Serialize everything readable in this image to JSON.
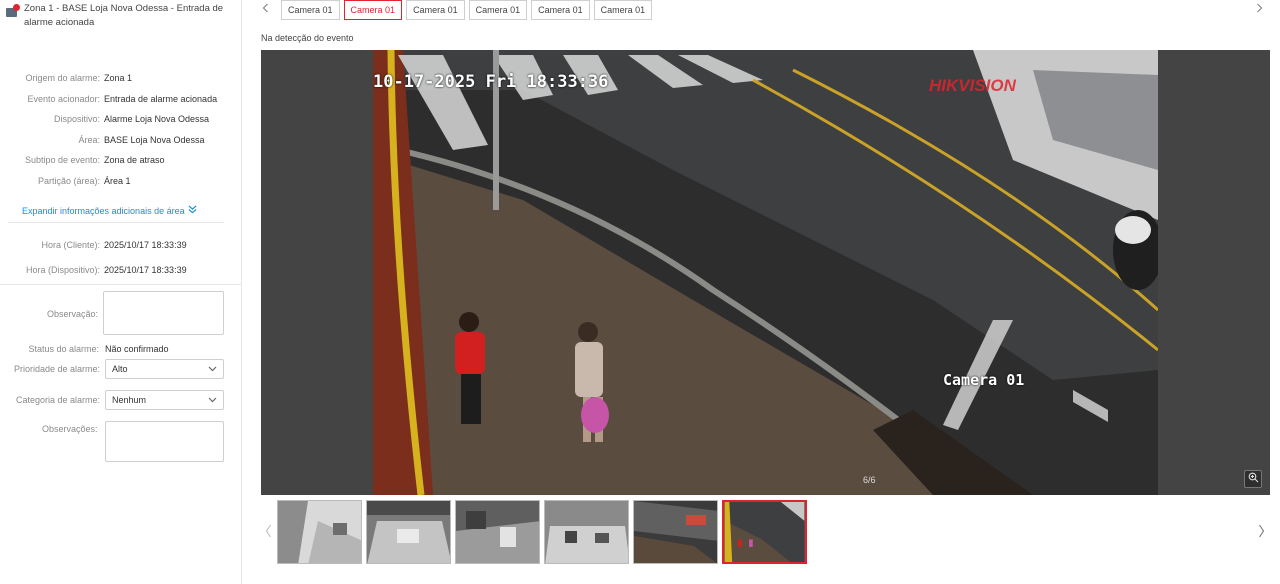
{
  "alarm": {
    "title": "Zona 1 - BASE Loja Nova Odessa - Entrada de alarme acionada",
    "details": [
      {
        "label": "Origem do alarme:",
        "value": "Zona 1"
      },
      {
        "label": "Evento acionador:",
        "value": "Entrada de alarme acionada"
      },
      {
        "label": "Dispositivo:",
        "value": "Alarme Loja Nova Odessa"
      },
      {
        "label": "Área:",
        "value": "BASE Loja Nova Odessa"
      },
      {
        "label": "Subtipo de evento:",
        "value": "Zona de atraso"
      },
      {
        "label": "Partição (área):",
        "value": "Área 1"
      }
    ],
    "expand_label": "Expandir informações adicionais de área",
    "times": [
      {
        "label": "Hora (Cliente):",
        "value": "2025/10/17 18:33:39"
      },
      {
        "label": "Hora (Dispositivo):",
        "value": "2025/10/17 18:33:39"
      }
    ],
    "observation_label": "Observação:",
    "status_label": "Status do alarme:",
    "status_value": "Não confirmado",
    "priority_label": "Prioridade de alarme:",
    "priority_value": "Alto",
    "category_label": "Categoria de alarme:",
    "category_value": "Nenhum",
    "notes_label": "Observações:"
  },
  "tabs": [
    "Camera 01",
    "Camera 01",
    "Camera 01",
    "Camera 01",
    "Camera 01",
    "Camera 01"
  ],
  "active_tab": 1,
  "viewer": {
    "caption": "Na detecção do evento",
    "osd_time": "10-17-2025 Fri 18:33:36",
    "osd_brand": "HIKVISION",
    "osd_camera": "Camera 01",
    "counter": "6/6"
  },
  "thumbnails_count": 6,
  "active_thumbnail": 5,
  "icons": {
    "alarm": "alarm-icon",
    "expand": "chevron-double-down-icon",
    "prev": "chevron-left-icon",
    "next": "chevron-right-icon",
    "zoom": "zoom-icon",
    "dropdown": "chevron-down-icon"
  },
  "colors": {
    "accent_red": "#e0232f",
    "link_blue": "#1a8fd6",
    "viewer_bg": "#444444"
  }
}
